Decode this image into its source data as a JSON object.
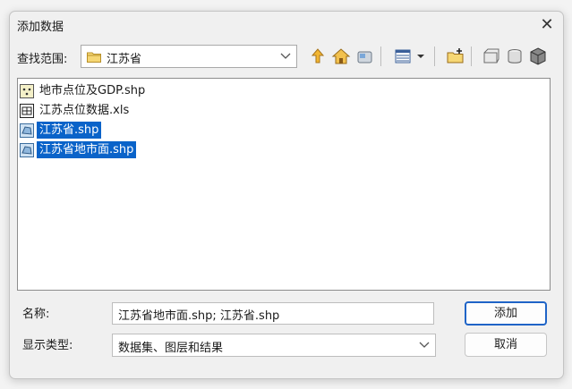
{
  "window": {
    "title": "添加数据",
    "close_glyph": "✕"
  },
  "lookin": {
    "label": "查找范围:",
    "value": "江苏省"
  },
  "toolbar": {
    "icons": [
      "up-one-level-icon",
      "home-icon",
      "connect-folder-icon",
      "view-options-icon",
      "new-folder-icon",
      "add-folder-icon",
      "catalog-icon",
      "toolbox-icon"
    ]
  },
  "files": [
    {
      "name": "地市点位及GDP.shp",
      "icon": "point-shapefile-icon",
      "selected": false
    },
    {
      "name": "江苏点位数据.xls",
      "icon": "table-file-icon",
      "selected": false
    },
    {
      "name": "江苏省.shp",
      "icon": "polygon-shapefile-icon",
      "selected": true
    },
    {
      "name": "江苏省地市面.shp",
      "icon": "polygon-shapefile-icon",
      "selected": true
    }
  ],
  "name_field": {
    "label": "名称:",
    "value": "江苏省地市面.shp; 江苏省.shp"
  },
  "type_field": {
    "label": "显示类型:",
    "value": "数据集、图层和结果"
  },
  "buttons": {
    "add": "添加",
    "cancel": "取消"
  },
  "colors": {
    "selection": "#0a63c9",
    "accent_border": "#1f64c7"
  }
}
